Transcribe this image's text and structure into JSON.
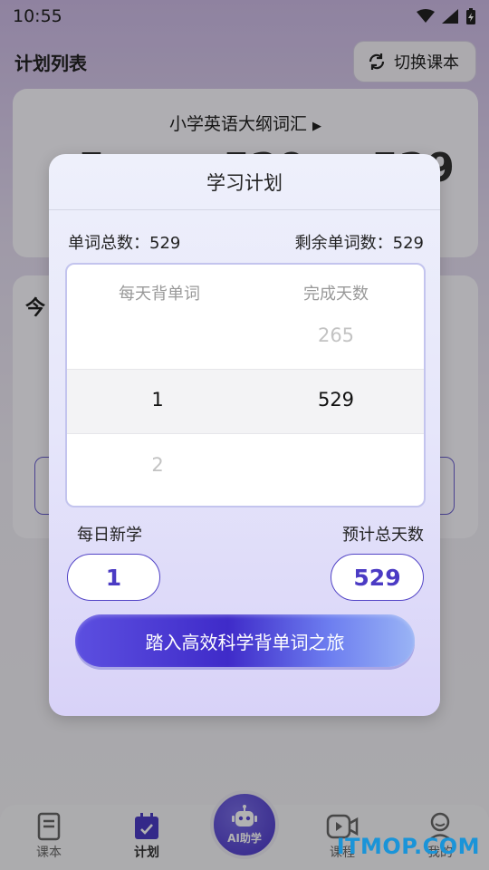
{
  "status": {
    "time": "10:55"
  },
  "header": {
    "title": "计划列表",
    "switch_label": "切换课本"
  },
  "card1": {
    "book_title": "小学英语大纲词汇",
    "big_left": "5",
    "big_mid": "529",
    "big_right": "529"
  },
  "card2": {
    "title": "今"
  },
  "modal": {
    "title": "学习计划",
    "total_words": "单词总数：529",
    "remaining_words": "剩余单词数：529",
    "picker": {
      "col1_header": "每天背单词",
      "col2_header": "完成天数",
      "col1_selected": "1",
      "col1_next": "2",
      "col2_prev": "265",
      "col2_selected": "529"
    },
    "daily_new_label": "每日新学",
    "estimated_days_label": "预计总天数",
    "daily_new_value": "1",
    "estimated_days_value": "529",
    "cta_label": "踏入高效科学背单词之旅"
  },
  "tabbar": {
    "tab_textbook": "课本",
    "tab_plan": "计划",
    "ai_label": "AI助学",
    "tab_course": "课程",
    "tab_mine": "我的"
  },
  "watermark": "ITMOP.COM",
  "colors": {
    "accent": "#4b3bc4",
    "picker_border": "#c3c4ee",
    "watermark": "#1a94d8"
  }
}
